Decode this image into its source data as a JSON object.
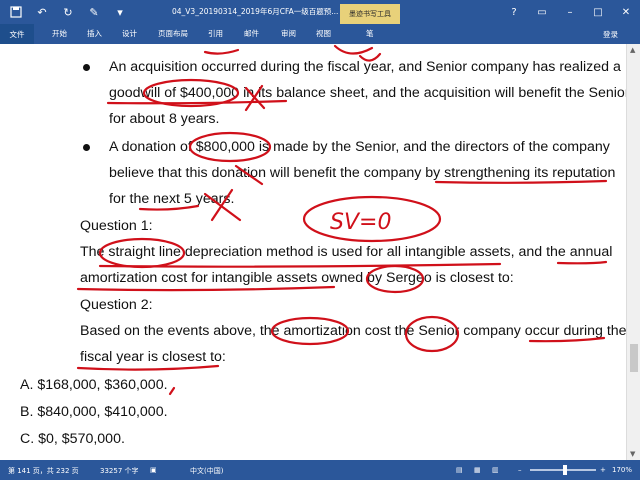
{
  "titlebar": {
    "doc_title": "04_V3_20190314_2019年6月CFA一级百题预...",
    "tool_tab": "墨迹书写工具",
    "qat_icons": [
      "save-icon",
      "undo-icon",
      "redo-icon",
      "pen-icon",
      "more-icon"
    ],
    "window_buttons": [
      "?",
      "▭",
      "–",
      "□",
      "✕"
    ]
  },
  "ribbon": {
    "file": "文件",
    "tabs": [
      "开始",
      "插入",
      "设计",
      "页面布局",
      "引用",
      "邮件",
      "审阅",
      "视图",
      "笔"
    ],
    "login": "登录"
  },
  "document": {
    "lines": [
      "An acquisition occurred during the fiscal year, and Senior company has realized a",
      "goodwill of $400,000 in its balance sheet, and the acquisition will benefit the Senior",
      "for about 8 years.",
      "A donation of $800,000 is made by the Senior, and the directors of the company",
      "believe that this donation will benefit the company by strengthening its reputation",
      "for the next 5 years.",
      "Question 1:",
      "The straight line depreciation method is used for all intangible assets, and the annual",
      "amortization cost for intangible assets owned by Sergeo is closest to:",
      "Question 2:",
      "Based on the events above, the amortization cost the Senior company occur during the",
      "fiscal year is closest to:",
      "A.   $168,000, $360,000.",
      "B.   $840,000, $410,000.",
      "C.   $0, $570,000."
    ],
    "handwriting": "SV=0"
  },
  "statusbar": {
    "page": "第 141 页，共 232 页",
    "words": "33257 个字",
    "language": "中文(中国)",
    "zoom": "170%",
    "zoom_minus": "–",
    "zoom_plus": "+",
    "zoom_level": 0.5
  },
  "colors": {
    "ribbon": "#2b579a",
    "ink": "#d0101a",
    "tool_tab": "#e8d17a"
  }
}
